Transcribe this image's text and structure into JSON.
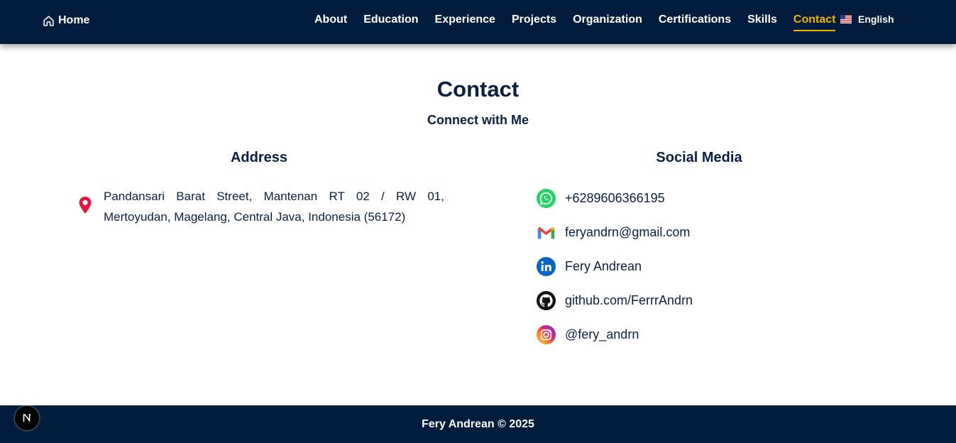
{
  "navbar": {
    "home_label": "Home",
    "items": [
      {
        "label": "About"
      },
      {
        "label": "Education"
      },
      {
        "label": "Experience"
      },
      {
        "label": "Projects"
      },
      {
        "label": "Organization"
      },
      {
        "label": "Certifications"
      },
      {
        "label": "Skills"
      },
      {
        "label": "Contact"
      }
    ],
    "active_item": "Contact",
    "language": {
      "label": "English",
      "flag_icon": "us-flag-icon"
    },
    "colors": {
      "background": "#021c3d",
      "active": "#f5b301",
      "text": "#ffffff"
    }
  },
  "page": {
    "title": "Contact",
    "subtitle": "Connect with Me"
  },
  "address": {
    "heading": "Address",
    "icon": "map-pin-icon",
    "text": "Pandansari Barat Street, Mantenan RT 02 / RW 01, Mertoyudan, Magelang, Central Java, Indonesia (56172)"
  },
  "social": {
    "heading": "Social Media",
    "items": [
      {
        "icon": "whatsapp-icon",
        "label": "+6289606366195"
      },
      {
        "icon": "gmail-icon",
        "label": "feryandrn@gmail.com"
      },
      {
        "icon": "linkedin-icon",
        "label": "Fery Andrean"
      },
      {
        "icon": "github-icon",
        "label": "github.com/FerrrAndrn"
      },
      {
        "icon": "instagram-icon",
        "label": "@fery_andrn"
      }
    ]
  },
  "footer": {
    "text": "Fery Andrean © 2025"
  },
  "dev_badge": {
    "icon": "nextjs-icon"
  }
}
